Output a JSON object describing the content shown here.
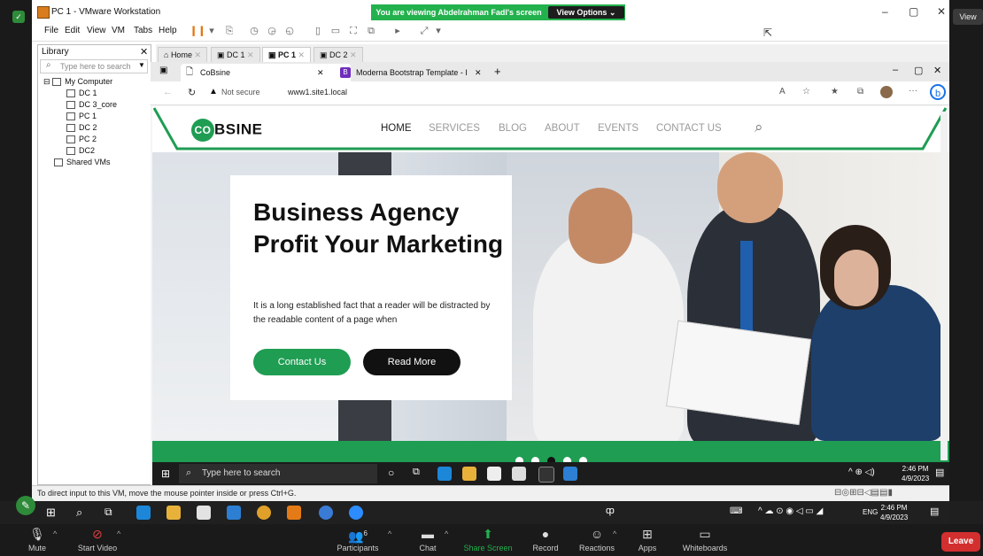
{
  "zoom": {
    "banner_text": "You are viewing Abdelrahman Fadl's screen",
    "view_options": "View Options",
    "view_label": "View",
    "controls": [
      {
        "label": "Mute",
        "icon": "microphone-icon"
      },
      {
        "label": "Start Video",
        "icon": "video-off-icon"
      },
      {
        "label": "Participants",
        "icon": "participants-icon",
        "count": "6"
      },
      {
        "label": "Chat",
        "icon": "chat-icon"
      },
      {
        "label": "Share Screen",
        "icon": "share-screen-icon"
      },
      {
        "label": "Record",
        "icon": "record-icon"
      },
      {
        "label": "Reactions",
        "icon": "reactions-icon"
      },
      {
        "label": "Apps",
        "icon": "apps-icon"
      },
      {
        "label": "Whiteboards",
        "icon": "whiteboard-icon"
      }
    ],
    "leave": "Leave",
    "share_color": "#23b14d",
    "leave_color": "#d32f2f"
  },
  "vmware": {
    "title": "PC 1 - VMware Workstation",
    "menu": [
      "File",
      "Edit",
      "View",
      "VM",
      "Tabs",
      "Help"
    ],
    "library": {
      "title": "Library",
      "search_placeholder": "Type here to search",
      "tree": [
        "My Computer",
        "DC 1",
        "DC 3_core",
        "PC 1",
        "DC 2",
        "PC 2",
        "DC2",
        "Shared VMs"
      ]
    },
    "tabs": [
      "Home",
      "DC 1",
      "PC 1",
      "DC 2"
    ],
    "status": "To direct input to this VM, move the mouse pointer inside or press Ctrl+G."
  },
  "browser": {
    "tabs": [
      "CoBsine",
      "Moderna Bootstrap Template - I"
    ],
    "warning": "Not secure",
    "url": "www1.site1.local"
  },
  "site": {
    "logo_mark": "CO",
    "logo_rest": "BSINE",
    "nav": [
      "HOME",
      "SERVICES",
      "BLOG",
      "ABOUT",
      "EVENTS",
      "CONTACT US"
    ],
    "hero_title": "Business Agency Profit Your Marketing",
    "hero_text": "It is a long established fact that a reader will be distracted by the readable content of a page when",
    "btn_contact": "Contact Us",
    "btn_more": "Read More",
    "accent": "#1f9d53"
  },
  "guest_taskbar": {
    "search_placeholder": "Type here to search",
    "time": "2:46 PM",
    "date": "4/9/2023"
  },
  "host_taskbar": {
    "lang": "ENG",
    "time": "2:46 PM",
    "date": "4/9/2023"
  }
}
